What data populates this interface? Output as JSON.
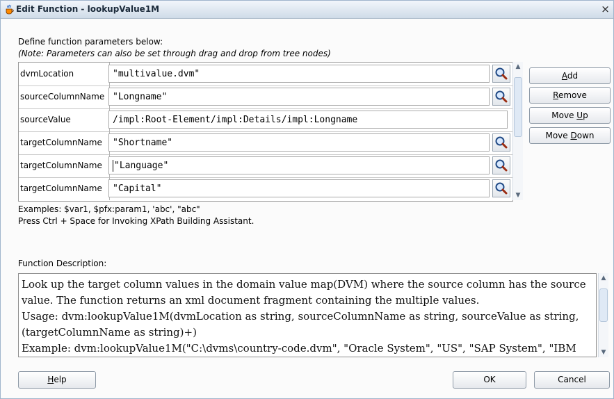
{
  "window": {
    "title": "Edit Function - lookupValue1M",
    "close_label": "×"
  },
  "intro": {
    "line1": "Define function parameters below:",
    "line2": "(Note: Parameters can also be set through drag and drop from tree nodes)"
  },
  "params": [
    {
      "name": "dvmLocation",
      "value": "\"multivalue.dvm\"",
      "has_button": true
    },
    {
      "name": "sourceColumnName",
      "value": "\"Longname\"",
      "has_button": true
    },
    {
      "name": "sourceValue",
      "value": "/impl:Root-Element/impl:Details/impl:Longname",
      "has_button": false
    },
    {
      "name": "targetColumnName",
      "value": "\"Shortname\"",
      "has_button": true
    },
    {
      "name": "targetColumnName",
      "value": "\"Language\"",
      "has_button": true
    },
    {
      "name": "targetColumnName",
      "value": "\"Capital\"",
      "has_button": true
    }
  ],
  "side_buttons": {
    "add": {
      "pre": "",
      "mn": "A",
      "post": "dd"
    },
    "remove": {
      "pre": "",
      "mn": "R",
      "post": "emove"
    },
    "move_up": {
      "pre": "Move ",
      "mn": "U",
      "post": "p"
    },
    "move_down": {
      "pre": "Move ",
      "mn": "D",
      "post": "own"
    }
  },
  "hints": {
    "examples": "Examples: $var1, $pfx:param1, 'abc', \"abc\"",
    "press": "Press Ctrl + Space for Invoking XPath Building Assistant."
  },
  "description": {
    "label": "Function Description:",
    "lines": [
      "Look up the target column values in the domain value map(DVM) where the source column has the source",
      "value. The function returns an xml document fragment containing the multiple values.",
      "Usage: dvm:lookupValue1M(dvmLocation as string, sourceColumnName as string, sourceValue as string,",
      "(targetColumnName as string)+)",
      "Example: dvm:lookupValue1M(\"C:\\dvms\\country-code.dvm\", \"Oracle System\", \"US\", \"SAP System\", \"IBM"
    ]
  },
  "footer": {
    "help": {
      "pre": "",
      "mn": "H",
      "post": "elp"
    },
    "ok": "OK",
    "cancel": "Cancel"
  },
  "icons": {
    "window": "java-cup-icon",
    "param_button": "magnifier-icon"
  }
}
